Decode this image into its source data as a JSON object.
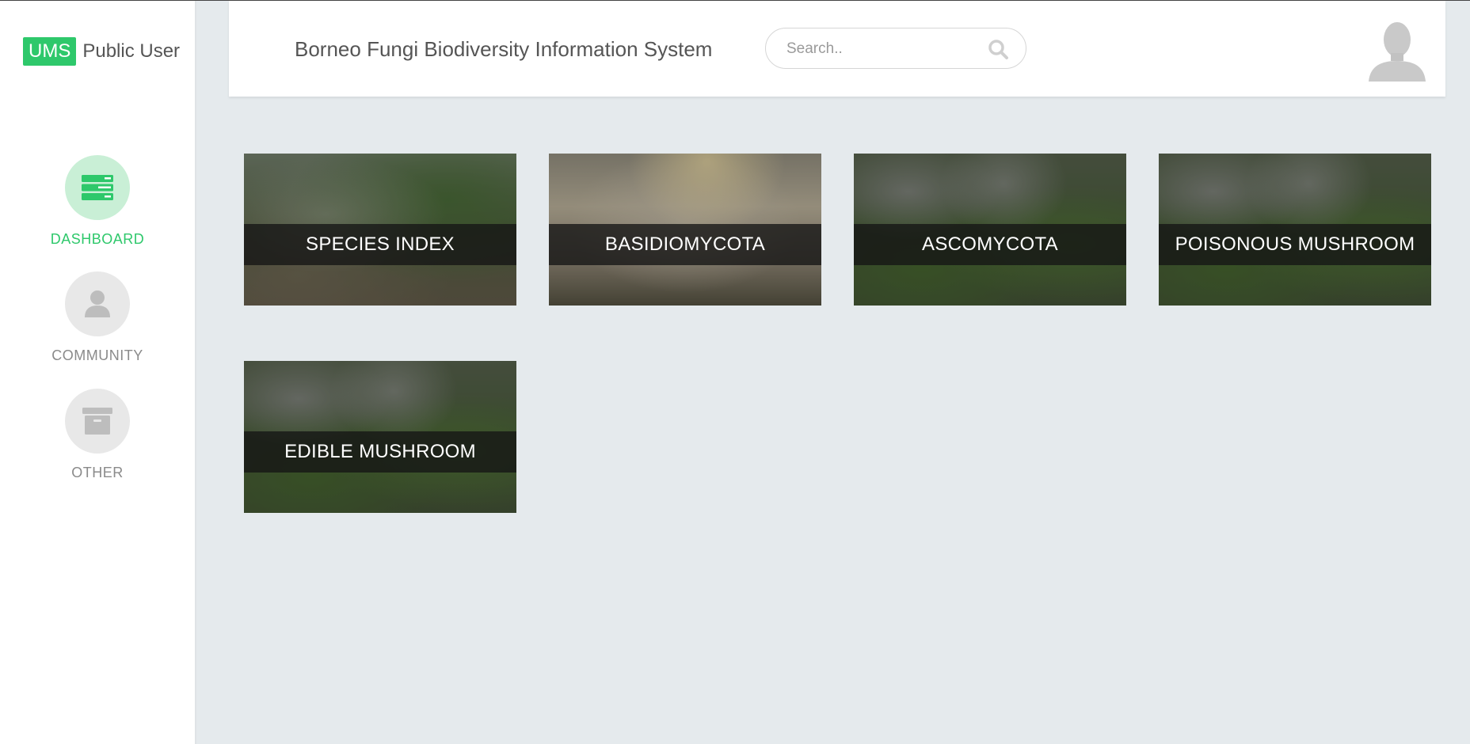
{
  "brand": {
    "badge": "UMS",
    "text": "Public User"
  },
  "nav": [
    {
      "label": "DASHBOARD",
      "icon": "dashboard-icon",
      "active": true
    },
    {
      "label": "COMMUNITY",
      "icon": "user-icon",
      "active": false
    },
    {
      "label": "OTHER",
      "icon": "archive-box-icon",
      "active": false
    }
  ],
  "header": {
    "title": "Borneo Fungi Biodiversity Information System",
    "search_placeholder": "Search.."
  },
  "tiles": [
    {
      "label": "SPECIES INDEX"
    },
    {
      "label": "BASIDIOMYCOTA"
    },
    {
      "label": "ASCOMYCOTA"
    },
    {
      "label": "POISONOUS MUSHROOM"
    },
    {
      "label": "EDIBLE MUSHROOM"
    }
  ],
  "colors": {
    "accent": "#2ec86b",
    "accent_light": "#c9efd6",
    "page_bg": "#e5eaed"
  }
}
